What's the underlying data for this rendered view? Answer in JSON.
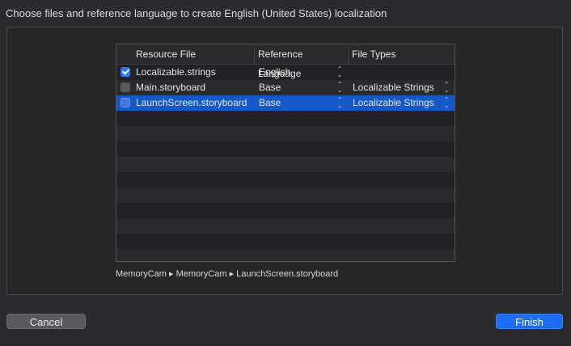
{
  "dialog": {
    "title": "Choose files and reference language to create English (United States) localization"
  },
  "table": {
    "columns": [
      "",
      "Resource File",
      "Reference Language",
      "File Types"
    ],
    "rows": [
      {
        "checked": true,
        "file": "Localizable.strings",
        "language": "English",
        "file_type": ""
      },
      {
        "checked": false,
        "file": "Main.storyboard",
        "language": "Base",
        "file_type": "Localizable Strings"
      },
      {
        "checked": false,
        "file": "LaunchScreen.storyboard",
        "language": "Base",
        "file_type": "Localizable Strings",
        "selected": true
      }
    ]
  },
  "path_bar": {
    "text": "MemoryCam ▸ MemoryCam ▸ LaunchScreen.storyboard"
  },
  "buttons": {
    "cancel": "Cancel",
    "finish": "Finish"
  },
  "colors": {
    "selection": "#1459c7",
    "accent": "#1e6cf0",
    "checkbox_on": "#2a7cf6"
  },
  "icons": {
    "stepper": "up-down-chevron-icon",
    "checkbox": "checkmark-icon"
  }
}
